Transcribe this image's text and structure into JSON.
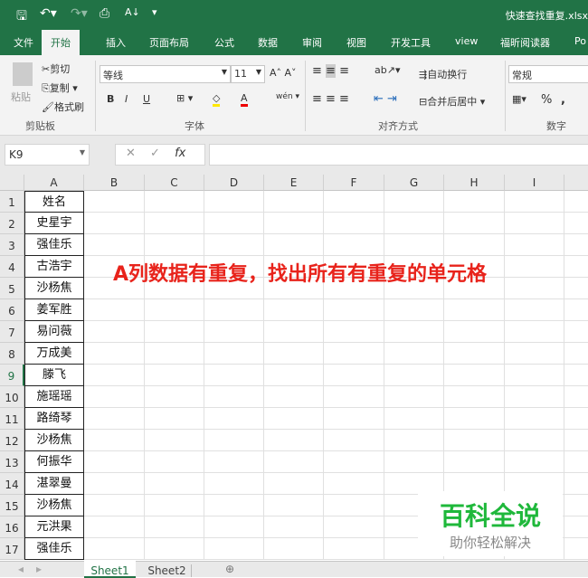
{
  "title_bar": {
    "filename": "快速查找重复.xlsx"
  },
  "ribbon_tabs": [
    "文件",
    "开始",
    "插入",
    "页面布局",
    "公式",
    "数据",
    "审阅",
    "视图",
    "开发工具",
    "view",
    "福昕阅读器",
    "Po"
  ],
  "ribbon": {
    "clipboard": {
      "paste": "粘贴",
      "cut": "剪切",
      "copy": "复制",
      "format_painter": "格式刷",
      "group": "剪贴板"
    },
    "font": {
      "name": "等线",
      "size": "11",
      "bold": "B",
      "italic": "I",
      "underline": "U",
      "group": "字体"
    },
    "alignment": {
      "wrap": "自动换行",
      "merge": "合并后居中",
      "group": "对齐方式"
    },
    "number": {
      "format": "常规",
      "percent": "%",
      "comma": ",",
      "group": "数字"
    }
  },
  "formula_bar": {
    "name_box": "K9",
    "value": ""
  },
  "columns": [
    "A",
    "B",
    "C",
    "D",
    "E",
    "F",
    "G",
    "H",
    "I"
  ],
  "rows": [
    "1",
    "2",
    "3",
    "4",
    "5",
    "6",
    "7",
    "8",
    "9",
    "10",
    "11",
    "12",
    "13",
    "14",
    "15",
    "16",
    "17"
  ],
  "column_a": [
    "姓名",
    "史星宇",
    "强佳乐",
    "古浩宇",
    "沙杨焦",
    "姜军胜",
    "易问薇",
    "万成美",
    "滕飞",
    "施瑶瑶",
    "路绮琴",
    "沙杨焦",
    "何振华",
    "湛翠曼",
    "沙杨焦",
    "元洪果",
    "强佳乐"
  ],
  "annotation": "A列数据有重复，找出所有有重复的单元格",
  "watermark": {
    "title": "百科全说",
    "subtitle": "助你轻松解决"
  },
  "sheet_tabs": [
    "Sheet1",
    "Sheet2"
  ]
}
